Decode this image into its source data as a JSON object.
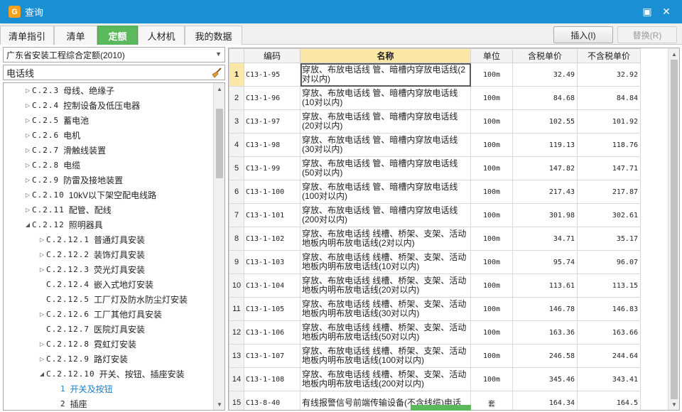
{
  "window": {
    "title": "查询"
  },
  "tabs": [
    {
      "label": "清单指引"
    },
    {
      "label": "清单"
    },
    {
      "label": "定额"
    },
    {
      "label": "人材机"
    },
    {
      "label": "我的数据"
    }
  ],
  "toolbar": {
    "insert_label": "插入(I)",
    "replace_label": "替换(R)"
  },
  "left": {
    "library": "广东省安装工程综合定额(2010)",
    "search_value": "电话线",
    "tree": [
      {
        "code": "C.2.3",
        "label": "母线、绝缘子",
        "level": 1,
        "expander": "collapsed"
      },
      {
        "code": "C.2.4",
        "label": "控制设备及低压电器",
        "level": 1,
        "expander": "collapsed"
      },
      {
        "code": "C.2.5",
        "label": "蓄电池",
        "level": 1,
        "expander": "collapsed"
      },
      {
        "code": "C.2.6",
        "label": "电机",
        "level": 1,
        "expander": "collapsed"
      },
      {
        "code": "C.2.7",
        "label": "滑触线装置",
        "level": 1,
        "expander": "collapsed"
      },
      {
        "code": "C.2.8",
        "label": "电缆",
        "level": 1,
        "expander": "collapsed"
      },
      {
        "code": "C.2.9",
        "label": "防雷及接地装置",
        "level": 1,
        "expander": "collapsed"
      },
      {
        "code": "C.2.10",
        "label": "10kV以下架空配电线路",
        "level": 1,
        "expander": "collapsed"
      },
      {
        "code": "C.2.11",
        "label": "配管、配线",
        "level": 1,
        "expander": "collapsed"
      },
      {
        "code": "C.2.12",
        "label": "照明器具",
        "level": 1,
        "expander": "expanded"
      },
      {
        "code": "C.2.12.1",
        "label": "普通灯具安装",
        "level": 2,
        "expander": "collapsed"
      },
      {
        "code": "C.2.12.2",
        "label": "装饰灯具安装",
        "level": 2,
        "expander": "collapsed"
      },
      {
        "code": "C.2.12.3",
        "label": "荧光灯具安装",
        "level": 2,
        "expander": "collapsed"
      },
      {
        "code": "C.2.12.4",
        "label": "嵌入式地灯安装",
        "level": 2,
        "expander": "none"
      },
      {
        "code": "C.2.12.5",
        "label": "工厂灯及防水防尘灯安装",
        "level": 2,
        "expander": "none"
      },
      {
        "code": "C.2.12.6",
        "label": "工厂其他灯具安装",
        "level": 2,
        "expander": "collapsed"
      },
      {
        "code": "C.2.12.7",
        "label": "医院灯具安装",
        "level": 2,
        "expander": "none"
      },
      {
        "code": "C.2.12.8",
        "label": "霓虹灯安装",
        "level": 2,
        "expander": "collapsed"
      },
      {
        "code": "C.2.12.9",
        "label": "路灯安装",
        "level": 2,
        "expander": "collapsed"
      },
      {
        "code": "C.2.12.10",
        "label": "开关、按钮、插座安装",
        "level": 2,
        "expander": "expanded"
      },
      {
        "code": "1",
        "label": "开关及按钮",
        "level": 3,
        "expander": "none",
        "selected": true
      },
      {
        "code": "2",
        "label": "插座",
        "level": 3,
        "expander": "none"
      }
    ]
  },
  "grid": {
    "headers": {
      "code": "编码",
      "name": "名称",
      "unit": "单位",
      "tax_price": "含税单价",
      "notax_price": "不含税单价"
    },
    "rows": [
      {
        "idx": "1",
        "code": "C13-1-95",
        "name": "穿放、布放电话线 管、暗槽内穿放电话线(2对以内)",
        "unit": "100m",
        "tax": "32.49",
        "notax": "32.92"
      },
      {
        "idx": "2",
        "code": "C13-1-96",
        "name": "穿放、布放电话线 管、暗槽内穿放电话线(10对以内)",
        "unit": "100m",
        "tax": "84.68",
        "notax": "84.84"
      },
      {
        "idx": "3",
        "code": "C13-1-97",
        "name": "穿放、布放电话线 管、暗槽内穿放电话线(20对以内)",
        "unit": "100m",
        "tax": "102.55",
        "notax": "101.92"
      },
      {
        "idx": "4",
        "code": "C13-1-98",
        "name": "穿放、布放电话线 管、暗槽内穿放电话线(30对以内)",
        "unit": "100m",
        "tax": "119.13",
        "notax": "118.76"
      },
      {
        "idx": "5",
        "code": "C13-1-99",
        "name": "穿放、布放电话线 管、暗槽内穿放电话线(50对以内)",
        "unit": "100m",
        "tax": "147.82",
        "notax": "147.71"
      },
      {
        "idx": "6",
        "code": "C13-1-100",
        "name": "穿放、布放电话线 管、暗槽内穿放电话线(100对以内)",
        "unit": "100m",
        "tax": "217.43",
        "notax": "217.87"
      },
      {
        "idx": "7",
        "code": "C13-1-101",
        "name": "穿放、布放电话线 管、暗槽内穿放电话线(200对以内)",
        "unit": "100m",
        "tax": "301.98",
        "notax": "302.61"
      },
      {
        "idx": "8",
        "code": "C13-1-102",
        "name": "穿放、布放电话线 线槽、桥架、支架、活动地板内明布放电话线(2对以内)",
        "unit": "100m",
        "tax": "34.71",
        "notax": "35.17"
      },
      {
        "idx": "9",
        "code": "C13-1-103",
        "name": "穿放、布放电话线 线槽、桥架、支架、活动地板内明布放电话线(10对以内)",
        "unit": "100m",
        "tax": "95.74",
        "notax": "96.07"
      },
      {
        "idx": "10",
        "code": "C13-1-104",
        "name": "穿放、布放电话线 线槽、桥架、支架、活动地板内明布放电话线(20对以内)",
        "unit": "100m",
        "tax": "113.61",
        "notax": "113.15"
      },
      {
        "idx": "11",
        "code": "C13-1-105",
        "name": "穿放、布放电话线 线槽、桥架、支架、活动地板内明布放电话线(30对以内)",
        "unit": "100m",
        "tax": "146.78",
        "notax": "146.83"
      },
      {
        "idx": "12",
        "code": "C13-1-106",
        "name": "穿放、布放电话线 线槽、桥架、支架、活动地板内明布放电话线(50对以内)",
        "unit": "100m",
        "tax": "163.36",
        "notax": "163.66"
      },
      {
        "idx": "13",
        "code": "C13-1-107",
        "name": "穿放、布放电话线 线槽、桥架、支架、活动地板内明布放电话线(100对以内)",
        "unit": "100m",
        "tax": "246.58",
        "notax": "244.64"
      },
      {
        "idx": "14",
        "code": "C13-1-108",
        "name": "穿放、布放电话线 线槽、桥架、支架、活动地板内明布放电话线(200对以内)",
        "unit": "100m",
        "tax": "345.46",
        "notax": "343.41"
      },
      {
        "idx": "15",
        "code": "C13-8-40",
        "name": "有线报警信号前端传输设备(不含线缆)电话",
        "unit": "套",
        "tax": "164.34",
        "notax": "164.5"
      }
    ]
  },
  "colors": {
    "titlebar": "#1a8fd4",
    "active_tab": "#5cb85c",
    "highlight": "#fbe7a6",
    "tree_selected": "#1a7fc4"
  }
}
